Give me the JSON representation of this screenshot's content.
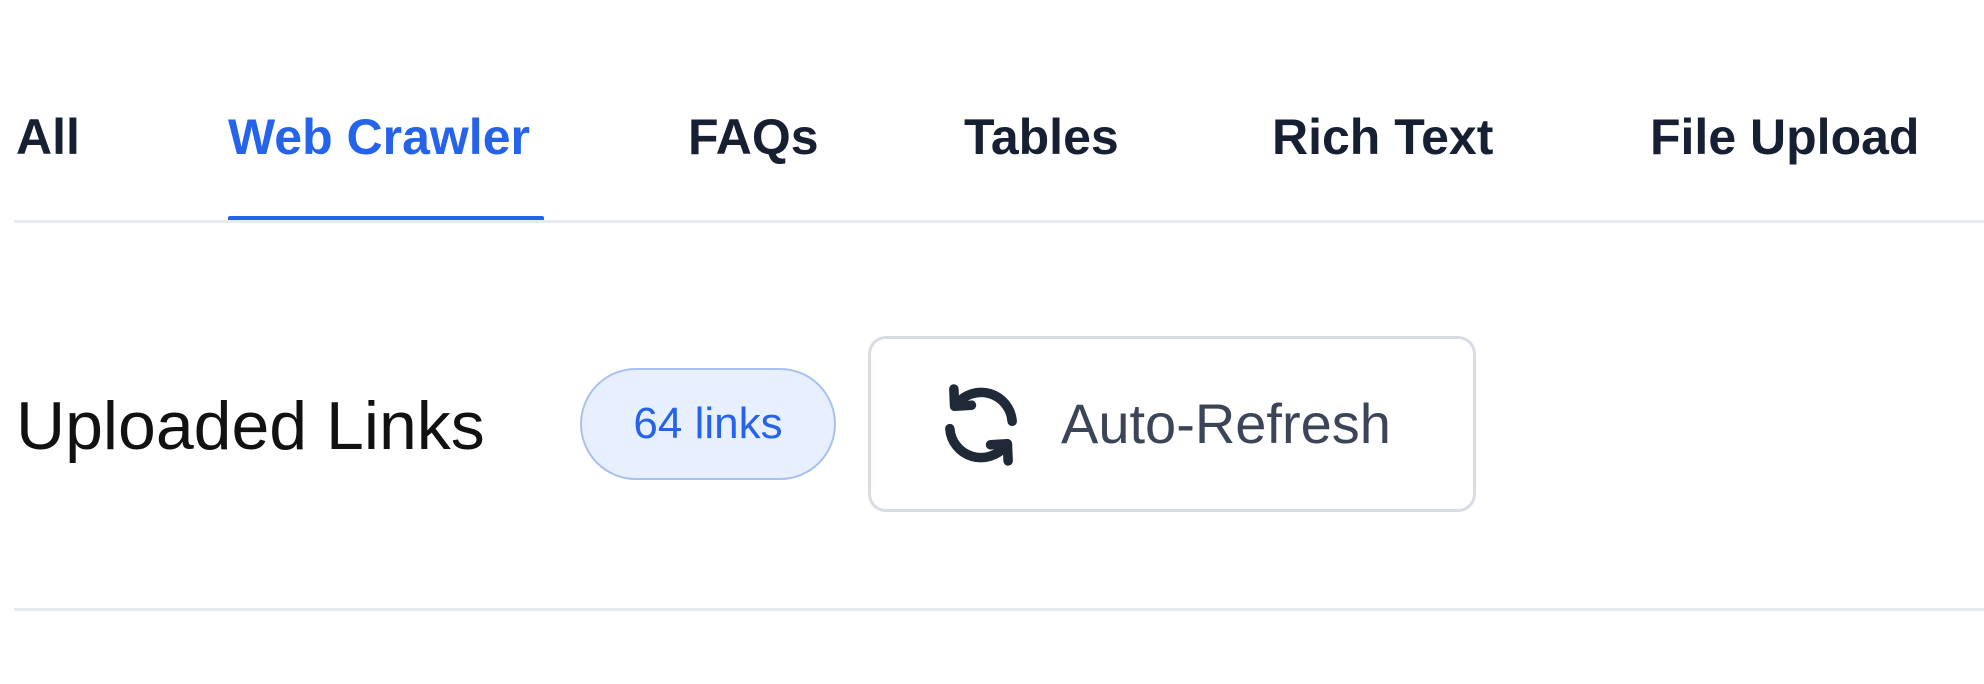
{
  "tabs": [
    {
      "label": "All",
      "active": false
    },
    {
      "label": "Web Crawler",
      "active": true
    },
    {
      "label": "FAQs",
      "active": false
    },
    {
      "label": "Tables",
      "active": false
    },
    {
      "label": "Rich Text",
      "active": false
    },
    {
      "label": "File Upload",
      "active": false
    }
  ],
  "section": {
    "title": "Uploaded Links",
    "count_badge": "64 links"
  },
  "refresh_button": {
    "label": "Auto-Refresh",
    "icon": "refresh-icon"
  },
  "colors": {
    "accent": "#2563eb",
    "tab_text": "#172033",
    "badge_bg": "#e8efff",
    "badge_border": "#a9c1f2",
    "divider": "#e7ebf0",
    "button_border": "#d9dde3"
  }
}
